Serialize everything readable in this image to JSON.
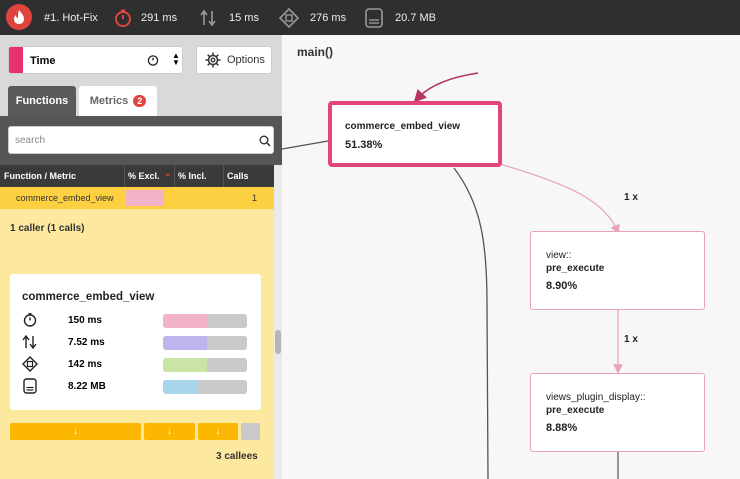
{
  "topbar": {
    "title": "#1. Hot-Fix",
    "time": "291 ms",
    "io": "15 ms",
    "cpu": "276 ms",
    "memory": "20.7 MB",
    "colors": {
      "logo": "#e0443f",
      "time_icon": "#e0443f"
    }
  },
  "sidebar": {
    "metric_select": {
      "value": "Time",
      "swatch_color": "#e7326f"
    },
    "options_label": "Options",
    "tabs": [
      {
        "label": "Functions",
        "active": true
      },
      {
        "label": "Metrics",
        "badge": "2"
      }
    ],
    "search": {
      "placeholder": "search"
    },
    "table": {
      "headers": [
        "Function / Metric",
        "% Excl.",
        "% Incl.",
        "Calls"
      ],
      "sort_indicator": "⌄",
      "rows": [
        {
          "name": "commerce_embed_view",
          "calls": "1",
          "excl_fraction": 0.8
        }
      ]
    },
    "callers": {
      "summary": "1 caller (1 calls)",
      "arrow": "↓"
    },
    "card": {
      "title": "commerce_embed_view",
      "metrics": [
        {
          "icon": "stopwatch-icon",
          "value": "150 ms",
          "fraction": 0.52,
          "color": "#f2b2c9"
        },
        {
          "icon": "io-arrows-icon",
          "value": "7.52 ms",
          "fraction": 0.52,
          "color": "#c0b4ef"
        },
        {
          "icon": "cpu-icon",
          "value": "142 ms",
          "fraction": 0.52,
          "color": "#c9e4a5"
        },
        {
          "icon": "memory-icon",
          "value": "8.22 MB",
          "fraction": 0.4,
          "color": "#a9d5ec"
        }
      ]
    },
    "callees": {
      "arrows": [
        "↓",
        "↓",
        "↓"
      ],
      "summary": "3 callees"
    }
  },
  "graph": {
    "root_label": "main()",
    "nodes": [
      {
        "name_line1": "commerce_embed_view",
        "name_line2": "",
        "percent": "51.38%",
        "selected": true
      },
      {
        "name_line1": "view::",
        "name_line2": "pre_execute",
        "percent": "8.90%"
      },
      {
        "name_line1": "views_plugin_display::",
        "name_line2": "pre_execute",
        "percent": "8.88%"
      }
    ],
    "edge_labels": [
      "1 x",
      "1 x"
    ],
    "colors": {
      "selected_border": "#e0457d",
      "edge": "#e8a2bd",
      "dark_edge": "#555555",
      "root_edge": "#b53660"
    }
  }
}
